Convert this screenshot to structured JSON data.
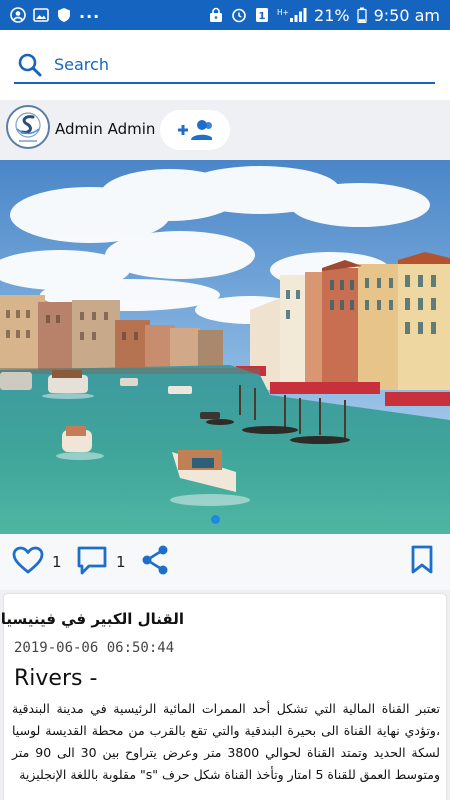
{
  "status_bar": {
    "battery_percent": "21%",
    "time": "9:50 am",
    "left_icons": [
      "account-circle-icon",
      "image-icon",
      "shield-icon"
    ],
    "right_icons": [
      "lock-icon",
      "alarm-icon",
      "sim-icon",
      "signal-icon",
      "battery-icon"
    ],
    "network": "H+"
  },
  "search": {
    "placeholder": "Search"
  },
  "author": {
    "name": "Admin Admin"
  },
  "post": {
    "likes": "1",
    "comments": "1",
    "title": "القنال الكبير في فينيسيا",
    "date": "2019-06-06 06:50:44",
    "category": "Rivers -",
    "body": "تعتبر القناة المالية التي تشكل أحد الممرات المائية الرئيسية في مدينة البندقية ،وتؤدي نهاية القناة الى بحيرة البندقية والتي تقع بالقرب من محطة القديسة لوسيا لسكة الحديد وتمتد القناة لحوالي 3800 متر وعرض يتراوح بين 30 الى 90 متر ومتوسط العمق للقناة 5 امتار وتأخذ القناة شكل حرف \"s\" مقلوبة باللغة الإنجليزية",
    "image_pages": 1,
    "current_page": 1
  },
  "colors": {
    "accent": "#1565c0",
    "icon_blue": "#1e6fc9",
    "background": "#eef0f3"
  }
}
